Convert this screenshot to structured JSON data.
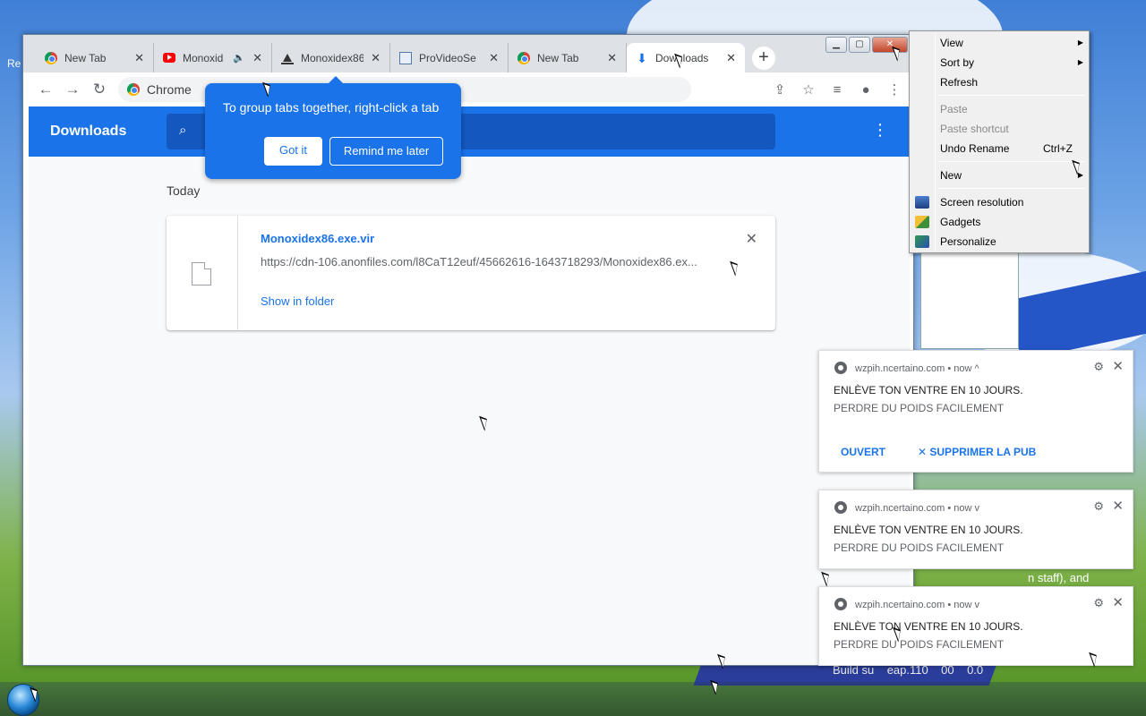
{
  "desktop": {
    "icon_label_fragment": "Re",
    "bg_text_1": "n staff), and",
    "bg_text_2": "Build su    eap.110    00    0.0"
  },
  "browser": {
    "tabs": [
      {
        "label": "New Tab",
        "favicon": "chrome-icon"
      },
      {
        "label": "Monoxid",
        "favicon": "youtube-icon",
        "audio": true
      },
      {
        "label": "Monoxidex86",
        "favicon": "mono-icon"
      },
      {
        "label": "ProVideoSe",
        "favicon": "pv-icon"
      },
      {
        "label": "New Tab",
        "favicon": "chrome-icon"
      },
      {
        "label": "Downloads",
        "favicon": "download-icon",
        "active": true
      }
    ],
    "omnibox_text": "Chrome",
    "page_title": "Downloads",
    "group_tip": {
      "message": "To group tabs together, right-click a tab",
      "got_it": "Got it",
      "remind": "Remind me later"
    },
    "section_date": "Today",
    "download": {
      "filename": "Monoxidex86.exe.vir",
      "url": "https://cdn-106.anonfiles.com/l8CaT12euf/45662616-1643718293/Monoxidex86.ex...",
      "show_in_folder": "Show in folder"
    }
  },
  "context_menu": {
    "items": [
      {
        "label": "View",
        "submenu": true
      },
      {
        "label": "Sort by",
        "submenu": true
      },
      {
        "label": "Refresh"
      },
      {
        "label": "Paste",
        "disabled": true
      },
      {
        "label": "Paste shortcut",
        "disabled": true
      },
      {
        "label": "Undo Rename",
        "shortcut": "Ctrl+Z"
      },
      {
        "label": "New",
        "submenu": true
      },
      {
        "label": "Screen resolution",
        "icon": "screen-icon"
      },
      {
        "label": "Gadgets",
        "icon": "gadgets-icon"
      },
      {
        "label": "Personalize",
        "icon": "personalize-icon"
      }
    ]
  },
  "notifications": [
    {
      "origin": "wzpih.ncertaino.com",
      "time": "now",
      "caret": "^",
      "title": "ENLÈVE TON VENTRE EN 10 JOURS.",
      "body": "PERDRE DU POIDS FACILEMENT",
      "action_open": "OUVERT",
      "action_remove": "SUPPRIMER LA PUB"
    },
    {
      "origin": "wzpih.ncertaino.com",
      "time": "now",
      "caret": "v",
      "title": "ENLÈVE TON VENTRE EN 10 JOURS.",
      "body": "PERDRE DU POIDS FACILEMENT"
    },
    {
      "origin": "wzpih.ncertaino.com",
      "time": "now",
      "caret": "v",
      "title": "ENLÈVE TON VENTRE EN 10 JOURS.",
      "body": "PERDRE DU POIDS FACILEMENT"
    }
  ],
  "notif_sep": "•",
  "colors": {
    "accent": "#1a73e8",
    "frame": "#dee1e6"
  }
}
